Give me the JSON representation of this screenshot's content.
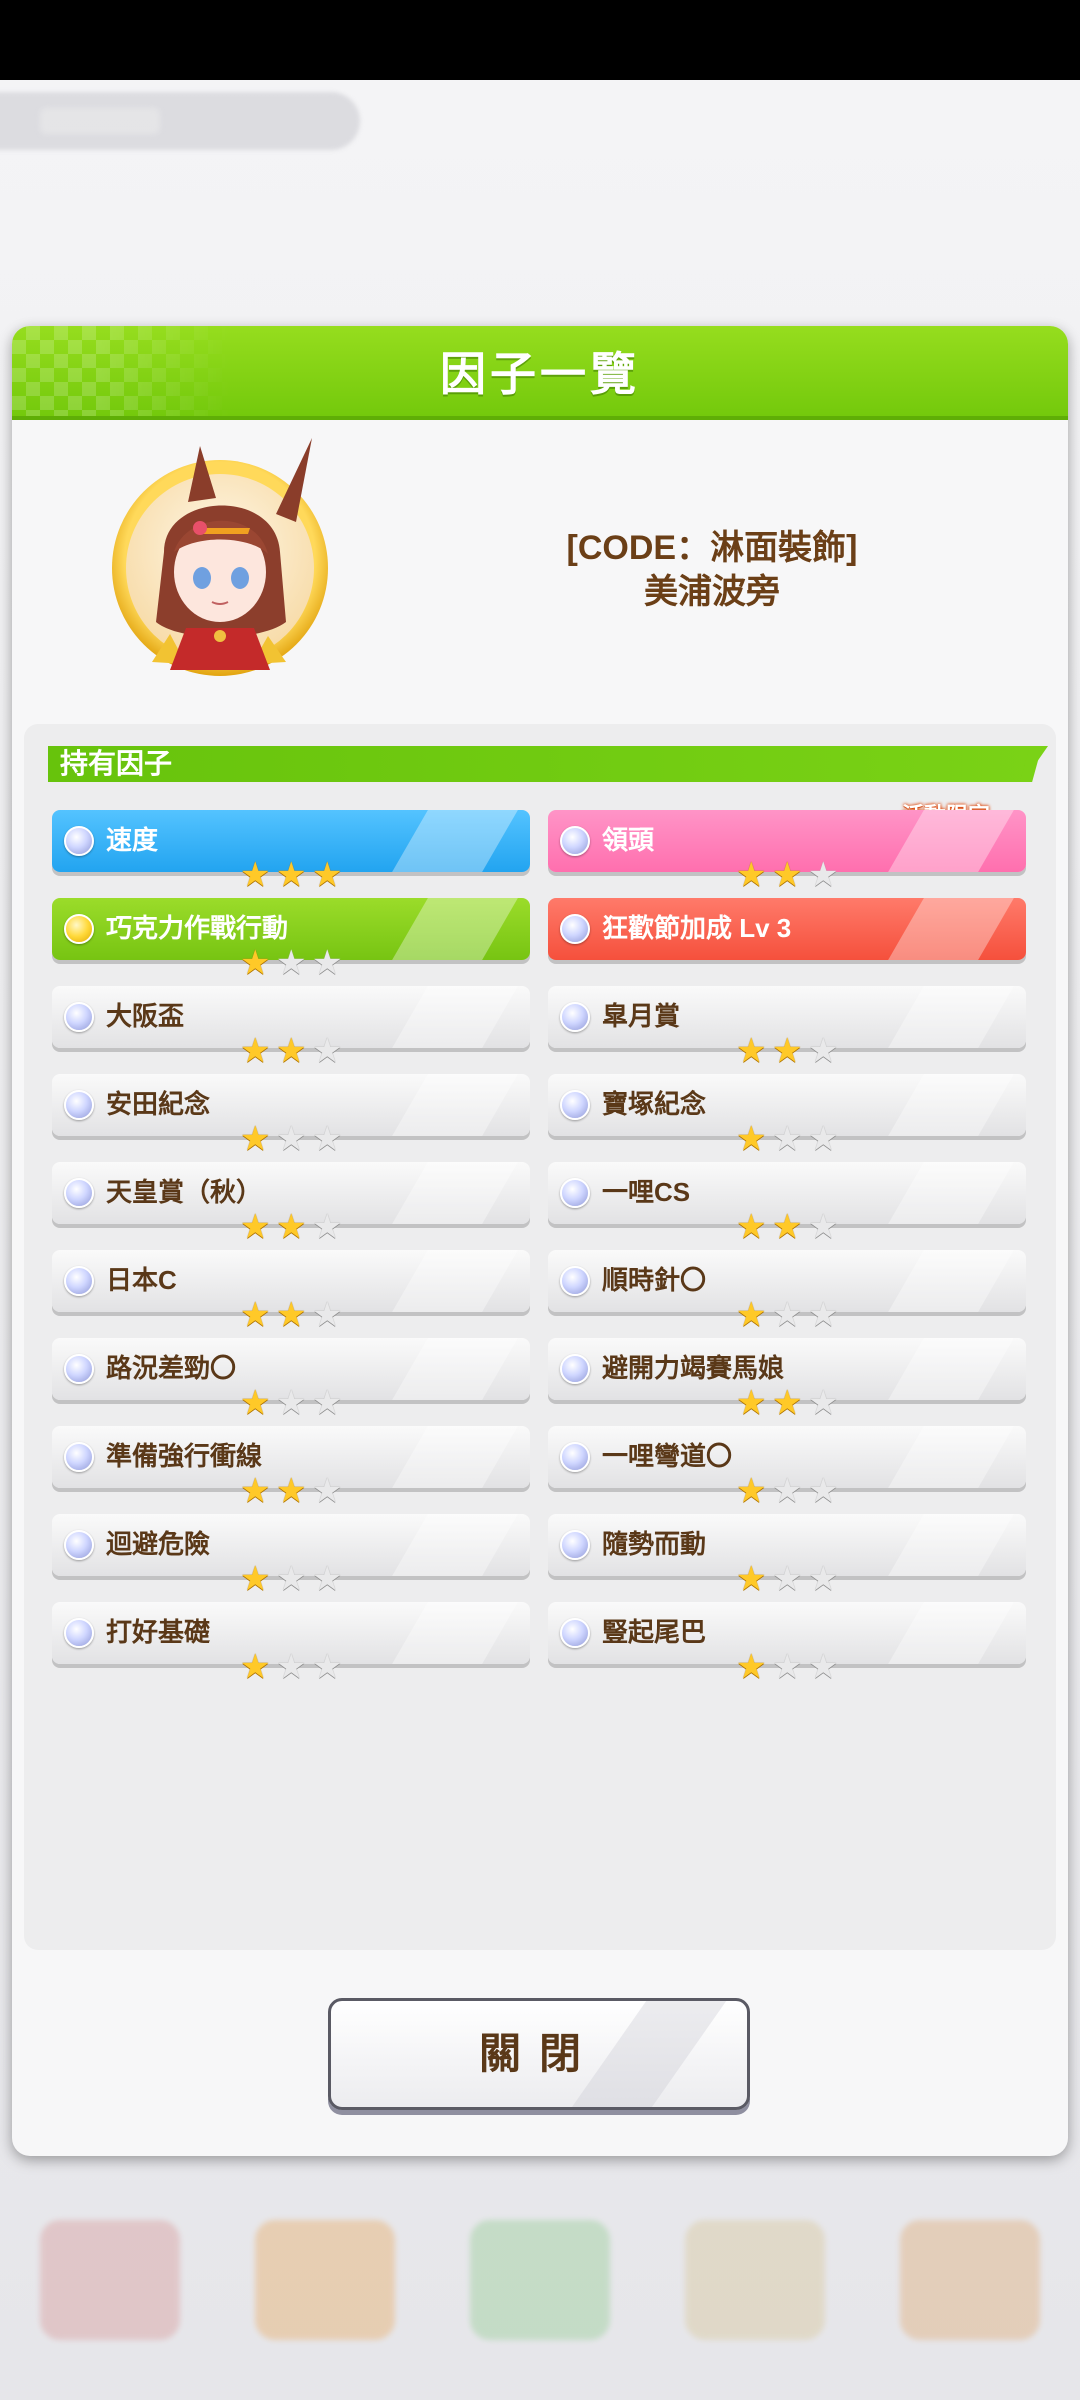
{
  "dialog": {
    "title": "因子一覽",
    "close_label": "關閉"
  },
  "character": {
    "title": "[CODE：淋面裝飾]",
    "name": "美浦波旁"
  },
  "factor_section": {
    "title": "持有因子",
    "limited_badge": "活動限定",
    "items": [
      {
        "label": "速度",
        "stars": 3,
        "color": "blue"
      },
      {
        "label": "領頭",
        "stars": 2,
        "color": "pink"
      },
      {
        "label": "巧克力作戰行動",
        "stars": 1,
        "color": "green"
      },
      {
        "label": "狂歡節加成 Lv 3",
        "stars": 0,
        "color": "red"
      },
      {
        "label": "大阪盃",
        "stars": 2,
        "color": "white"
      },
      {
        "label": "皐月賞",
        "stars": 2,
        "color": "white"
      },
      {
        "label": "安田紀念",
        "stars": 1,
        "color": "white"
      },
      {
        "label": "寶塚紀念",
        "stars": 1,
        "color": "white"
      },
      {
        "label": "天皇賞（秋）",
        "stars": 2,
        "color": "white"
      },
      {
        "label": "一哩CS",
        "stars": 2,
        "color": "white"
      },
      {
        "label": "日本C",
        "stars": 2,
        "color": "white"
      },
      {
        "label": "順時針〇",
        "stars": 1,
        "color": "white"
      },
      {
        "label": "路況差勁〇",
        "stars": 1,
        "color": "white"
      },
      {
        "label": "避開力竭賽馬娘",
        "stars": 2,
        "color": "white"
      },
      {
        "label": "準備強行衝線",
        "stars": 2,
        "color": "white"
      },
      {
        "label": "一哩彎道〇",
        "stars": 1,
        "color": "white"
      },
      {
        "label": "迴避危險",
        "stars": 1,
        "color": "white"
      },
      {
        "label": "隨勢而動",
        "stars": 1,
        "color": "white"
      },
      {
        "label": "打好基礎",
        "stars": 1,
        "color": "white"
      },
      {
        "label": "豎起尾巴",
        "stars": 1,
        "color": "white"
      }
    ]
  }
}
